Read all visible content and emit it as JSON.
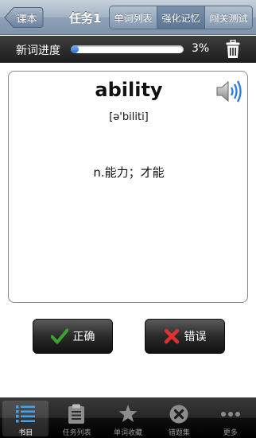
{
  "navbar": {
    "back_label": "课本",
    "title": "任务1",
    "segments": [
      {
        "label": "单词列表",
        "active": false
      },
      {
        "label": "强化记忆",
        "active": true
      },
      {
        "label": "闯关测试",
        "active": false
      }
    ]
  },
  "progress": {
    "label": "新词进度",
    "percent_text": "3%",
    "value": 0.03
  },
  "card": {
    "word": "ability",
    "phonetic": "[ə'biliti]",
    "meaning": "n.能力；才能",
    "speaker_icon": "speaker-icon"
  },
  "buttons": {
    "correct_label": "正确",
    "wrong_label": "错误"
  },
  "tabs": [
    {
      "label": "书目",
      "icon": "list-icon",
      "active": true
    },
    {
      "label": "任务列表",
      "icon": "clipboard-icon",
      "active": false
    },
    {
      "label": "单词收藏",
      "icon": "star-icon",
      "active": false
    },
    {
      "label": "错题集",
      "icon": "x-circle-icon",
      "active": false
    },
    {
      "label": "更多",
      "icon": "more-icon",
      "active": false
    }
  ],
  "colors": {
    "nav_blue": "#8ea1b7",
    "progress_fill": "#2a6fd0",
    "correct_green": "#3ca32e",
    "wrong_red": "#e03030",
    "tab_active": "#4da0e0"
  }
}
